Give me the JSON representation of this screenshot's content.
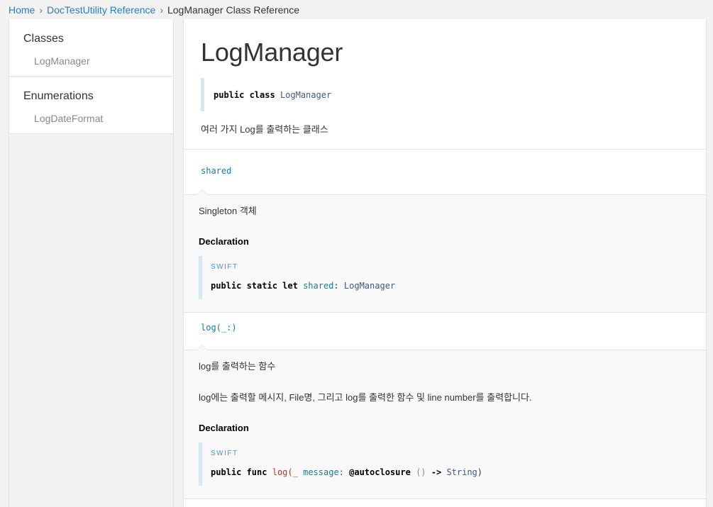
{
  "breadcrumb": {
    "home": "Home",
    "reference": "DocTestUtility Reference",
    "current": "LogManager Class Reference"
  },
  "sidebar": {
    "groups": [
      {
        "name": "Classes",
        "items": [
          "LogManager"
        ]
      },
      {
        "name": "Enumerations",
        "items": [
          "LogDateFormat"
        ]
      }
    ]
  },
  "main": {
    "title": "LogManager",
    "declaration": {
      "kw": "public class",
      "type": "LogManager"
    },
    "abstract": "여러 가지 Log를 출력하는 클래스",
    "members": [
      {
        "name": "shared",
        "description": [
          "Singleton 객체"
        ],
        "declaration_title": "Declaration",
        "language": "SWIFT",
        "code": {
          "kw": "public static let",
          "ident": "shared",
          "colon": ":",
          "type": "LogManager"
        }
      },
      {
        "name": "log(_:)",
        "description": [
          "log를 출력하는 함수",
          "log에는 출력할 메시지, File명, 그리고 log를 출력한 함수 및 line number를 출력합니다."
        ],
        "declaration_title": "Declaration",
        "language": "SWIFT",
        "code": {
          "kw": "public func",
          "ident": "log",
          "open": "(_",
          "param": "message:",
          "attr": "@autoclosure",
          "parens": "()",
          "arrow": "->",
          "type": "String",
          "close": ")"
        }
      }
    ]
  },
  "colors": {
    "link": "#2a7ec1",
    "code_ident": "#1777aa",
    "code_red": "#b8372c",
    "code_teal": "#1b7a8a",
    "declaration_bar": "#d6e8f4"
  }
}
